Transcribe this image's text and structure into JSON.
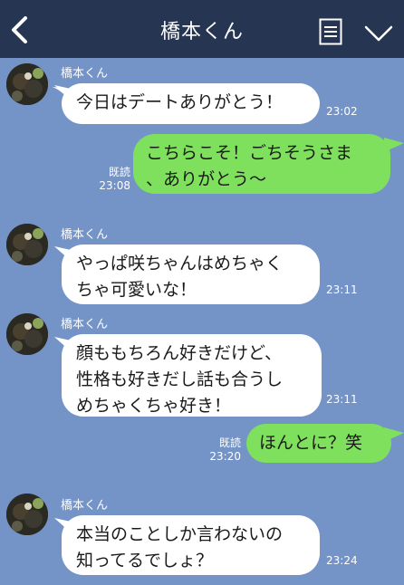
{
  "header": {
    "title": "橋本くん",
    "back_icon": "chevron-left-icon",
    "menu_icon": "notes-icon",
    "collapse_icon": "chevron-down-icon"
  },
  "colors": {
    "header_bg": "#253552",
    "chat_bg": "#7493c6",
    "incoming_bubble": "#ffffff",
    "outgoing_bubble": "#7fe05d"
  },
  "messages": [
    {
      "direction": "in",
      "sender": "橋本くん",
      "text": "今日はデートありがとう！",
      "time": "23:02"
    },
    {
      "direction": "out",
      "text": "こちらこそ！ごちそうさま\n、ありがとう〜",
      "read": "既読",
      "time": "23:08"
    },
    {
      "direction": "in",
      "sender": "橋本くん",
      "text": "やっぱ咲ちゃんはめちゃく\nちゃ可愛いな！",
      "time": "23:11"
    },
    {
      "direction": "in",
      "sender": "橋本くん",
      "text": "顔ももちろん好きだけど、\n性格も好きだし話も合うし\nめちゃくちゃ好き！",
      "time": "23:11"
    },
    {
      "direction": "out",
      "text": "ほんとに？笑",
      "read": "既読",
      "time": "23:20"
    },
    {
      "direction": "in",
      "sender": "橋本くん",
      "text": "本当のことしか言わないの\n知ってるでしょ？",
      "time": "23:24"
    }
  ]
}
